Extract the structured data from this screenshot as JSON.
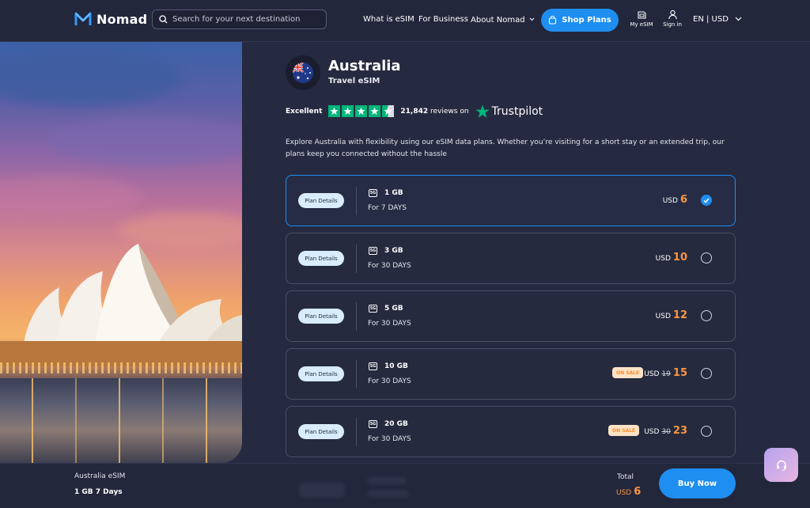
{
  "brand": {
    "name": "Nomad",
    "logo_icon": "nomad-logo-icon"
  },
  "search": {
    "placeholder": "Search for your next destination",
    "icon": "search-icon"
  },
  "nav": {
    "links": [
      "What is eSIM",
      "For Business",
      "About Nomad"
    ],
    "shop_button": "Shop Plans",
    "my_esim": "My eSIM",
    "sign_in": "Sign in",
    "lang_currency": "EN | USD"
  },
  "country": {
    "name": "Australia",
    "subtitle": "Travel eSIM",
    "flag_icon": "australia-flag-icon"
  },
  "rating": {
    "label": "Excellent",
    "stars": 4.5,
    "reviews_count": "21,842",
    "reviews_suffix": "reviews on",
    "provider": "Trustpilot"
  },
  "description": "Explore Australia with flexibility using our eSIM data plans. Whether you’re visiting for a short stay or an extended trip, our plans keep you connected without the hassle",
  "plans": [
    {
      "details_label": "Plan Details",
      "network": "5G",
      "data": "1 GB",
      "days": "For 7 DAYS",
      "currency": "USD",
      "price": "6",
      "old_price": "",
      "sale": "",
      "selected": true
    },
    {
      "details_label": "Plan Details",
      "network": "5G",
      "data": "3 GB",
      "days": "For 30 DAYS",
      "currency": "USD",
      "price": "10",
      "old_price": "",
      "sale": "",
      "selected": false
    },
    {
      "details_label": "Plan Details",
      "network": "5G",
      "data": "5 GB",
      "days": "For 30 DAYS",
      "currency": "USD",
      "price": "12",
      "old_price": "",
      "sale": "",
      "selected": false
    },
    {
      "details_label": "Plan Details",
      "network": "5G",
      "data": "10 GB",
      "days": "For 30 DAYS",
      "currency": "USD",
      "price": "15",
      "old_price": "19",
      "sale": "ON SALE",
      "selected": false
    },
    {
      "details_label": "Plan Details",
      "network": "5G",
      "data": "20 GB",
      "days": "For 30 DAYS",
      "currency": "USD",
      "price": "23",
      "old_price": "30",
      "sale": "ON SALE",
      "selected": false
    }
  ],
  "bottom": {
    "product": "Australia eSIM",
    "plan": "1 GB 7 Days",
    "total_label": "Total",
    "currency": "USD",
    "total": "6",
    "buy_button": "Buy Now"
  },
  "colors": {
    "accent": "#1e8ef0",
    "price": "#ff9640",
    "trustpilot": "#00b67a",
    "background": "#262a40"
  }
}
